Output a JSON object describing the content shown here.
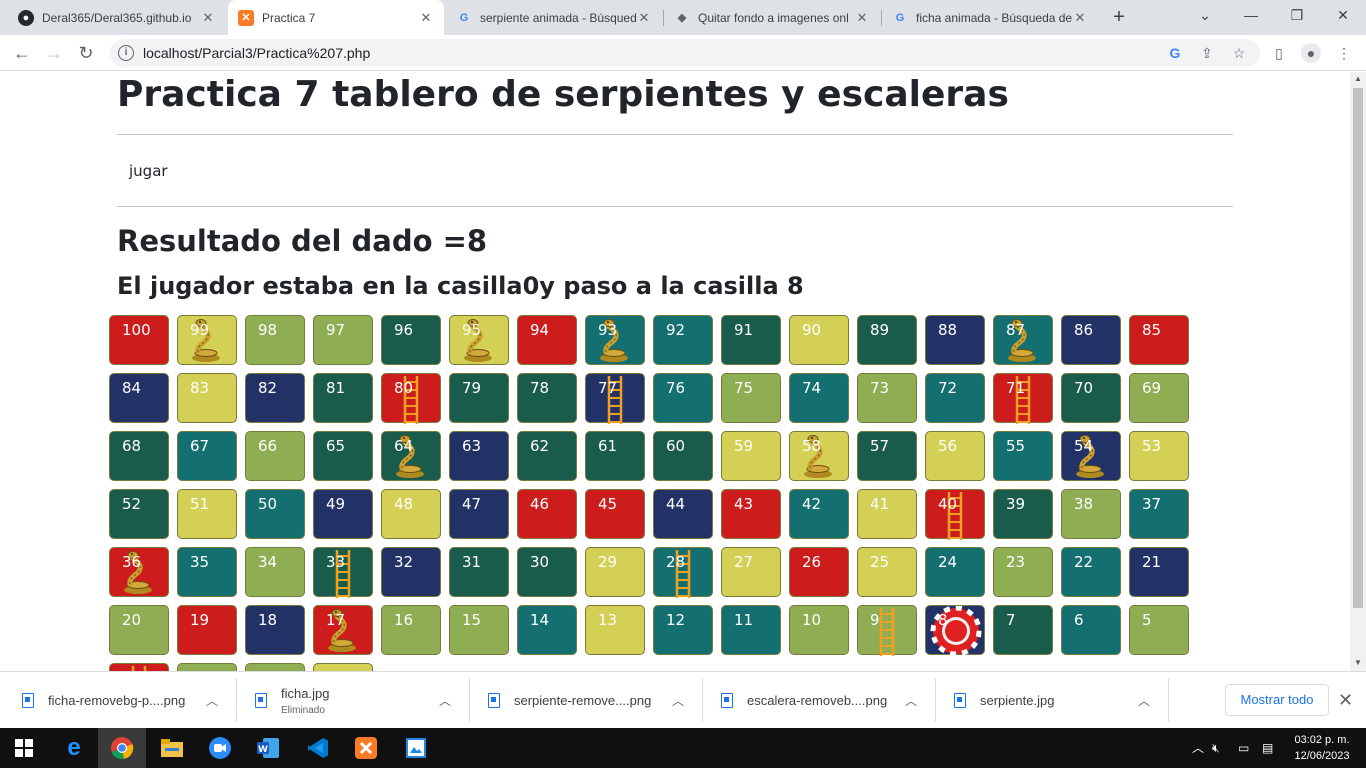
{
  "browser": {
    "tabs": [
      {
        "title": "Deral365/Deral365.github.io",
        "icon": "github-icon"
      },
      {
        "title": "Practica 7",
        "icon": "xampp-icon",
        "active": true
      },
      {
        "title": "serpiente animada - Búsqued",
        "icon": "google-icon"
      },
      {
        "title": "Quitar fondo a imagenes onl",
        "icon": "removebg-icon"
      },
      {
        "title": "ficha animada - Búsqueda de",
        "icon": "google-icon"
      }
    ],
    "url": "localhost/Parcial3/Practica%207.php"
  },
  "page": {
    "title": "Practica 7 tablero de serpientes y escaleras",
    "jugar_label": "jugar",
    "dice_result": "Resultado del dado =8",
    "move_text": "El jugador estaba en la casilla0y paso a la casilla 8"
  },
  "board": {
    "current_cell": 8,
    "colors": {
      "red": "#cc1c1c",
      "yellow": "#d4cf55",
      "olive": "#8fad52",
      "dgreen": "#1a5c4c",
      "teal": "#147070",
      "navy": "#223266"
    },
    "rows": [
      [
        {
          "n": "100",
          "c": "red"
        },
        {
          "n": "99",
          "c": "yellow",
          "o": "snake"
        },
        {
          "n": "98",
          "c": "olive"
        },
        {
          "n": "97",
          "c": "olive"
        },
        {
          "n": "96",
          "c": "dgreen"
        },
        {
          "n": "95",
          "c": "yellow",
          "o": "snake"
        },
        {
          "n": "94",
          "c": "red"
        },
        {
          "n": "93",
          "c": "teal",
          "o": "snake"
        },
        {
          "n": "92",
          "c": "teal"
        },
        {
          "n": "91",
          "c": "dgreen"
        },
        {
          "n": "90",
          "c": "yellow"
        },
        {
          "n": "89",
          "c": "dgreen"
        },
        {
          "n": "88",
          "c": "navy"
        },
        {
          "n": "87",
          "c": "teal",
          "o": "snake"
        },
        {
          "n": "86",
          "c": "navy"
        },
        {
          "n": "85",
          "c": "red"
        }
      ],
      [
        {
          "n": "84",
          "c": "navy"
        },
        {
          "n": "83",
          "c": "yellow"
        },
        {
          "n": "82",
          "c": "navy"
        },
        {
          "n": "81",
          "c": "dgreen"
        },
        {
          "n": "80",
          "c": "red",
          "o": "ladder"
        },
        {
          "n": "79",
          "c": "dgreen"
        },
        {
          "n": "78",
          "c": "dgreen"
        },
        {
          "n": "77",
          "c": "navy",
          "o": "ladder"
        },
        {
          "n": "76",
          "c": "teal"
        },
        {
          "n": "75",
          "c": "olive"
        },
        {
          "n": "74",
          "c": "teal"
        },
        {
          "n": "73",
          "c": "olive"
        },
        {
          "n": "72",
          "c": "teal"
        },
        {
          "n": "71",
          "c": "red",
          "o": "ladder"
        },
        {
          "n": "70",
          "c": "dgreen"
        },
        {
          "n": "69",
          "c": "olive"
        }
      ],
      [
        {
          "n": "68",
          "c": "dgreen"
        },
        {
          "n": "67",
          "c": "teal"
        },
        {
          "n": "66",
          "c": "olive"
        },
        {
          "n": "65",
          "c": "dgreen"
        },
        {
          "n": "64",
          "c": "dgreen",
          "o": "snake"
        },
        {
          "n": "63",
          "c": "navy"
        },
        {
          "n": "62",
          "c": "dgreen"
        },
        {
          "n": "61",
          "c": "dgreen"
        },
        {
          "n": "60",
          "c": "dgreen"
        },
        {
          "n": "59",
          "c": "yellow"
        },
        {
          "n": "58",
          "c": "yellow",
          "o": "snake"
        },
        {
          "n": "57",
          "c": "dgreen"
        },
        {
          "n": "56",
          "c": "yellow"
        },
        {
          "n": "55",
          "c": "teal"
        },
        {
          "n": "54",
          "c": "navy",
          "o": "snake"
        },
        {
          "n": "53",
          "c": "yellow"
        }
      ],
      [
        {
          "n": "52",
          "c": "dgreen"
        },
        {
          "n": "51",
          "c": "yellow"
        },
        {
          "n": "50",
          "c": "teal"
        },
        {
          "n": "49",
          "c": "navy"
        },
        {
          "n": "48",
          "c": "yellow"
        },
        {
          "n": "47",
          "c": "navy"
        },
        {
          "n": "46",
          "c": "red"
        },
        {
          "n": "45",
          "c": "red"
        },
        {
          "n": "44",
          "c": "navy"
        },
        {
          "n": "43",
          "c": "red"
        },
        {
          "n": "42",
          "c": "teal"
        },
        {
          "n": "41",
          "c": "yellow"
        },
        {
          "n": "40",
          "c": "red",
          "o": "ladder"
        },
        {
          "n": "39",
          "c": "dgreen"
        },
        {
          "n": "38",
          "c": "olive"
        },
        {
          "n": "37",
          "c": "teal"
        }
      ],
      [
        {
          "n": "36",
          "c": "red",
          "o": "snake"
        },
        {
          "n": "35",
          "c": "teal"
        },
        {
          "n": "34",
          "c": "olive"
        },
        {
          "n": "33",
          "c": "dgreen",
          "o": "ladder"
        },
        {
          "n": "32",
          "c": "navy"
        },
        {
          "n": "31",
          "c": "dgreen"
        },
        {
          "n": "30",
          "c": "dgreen"
        },
        {
          "n": "29",
          "c": "yellow"
        },
        {
          "n": "28",
          "c": "teal",
          "o": "ladder"
        },
        {
          "n": "27",
          "c": "yellow"
        },
        {
          "n": "26",
          "c": "red"
        },
        {
          "n": "25",
          "c": "yellow"
        },
        {
          "n": "24",
          "c": "teal"
        },
        {
          "n": "23",
          "c": "olive"
        },
        {
          "n": "22",
          "c": "teal"
        },
        {
          "n": "21",
          "c": "navy"
        }
      ],
      [
        {
          "n": "20",
          "c": "olive"
        },
        {
          "n": "19",
          "c": "red"
        },
        {
          "n": "18",
          "c": "navy"
        },
        {
          "n": "17",
          "c": "red",
          "o": "snake"
        },
        {
          "n": "16",
          "c": "olive"
        },
        {
          "n": "15",
          "c": "olive"
        },
        {
          "n": "14",
          "c": "teal"
        },
        {
          "n": "13",
          "c": "yellow"
        },
        {
          "n": "12",
          "c": "teal"
        },
        {
          "n": "11",
          "c": "teal"
        },
        {
          "n": "10",
          "c": "olive"
        },
        {
          "n": "9",
          "c": "olive",
          "o": "ladder"
        },
        {
          "n": "8",
          "c": "navy",
          "o": "chip"
        },
        {
          "n": "7",
          "c": "dgreen"
        },
        {
          "n": "6",
          "c": "teal"
        },
        {
          "n": "5",
          "c": "olive"
        }
      ],
      [
        {
          "n": "",
          "c": "red",
          "o": "ladder"
        },
        {
          "n": "",
          "c": "olive"
        },
        {
          "n": "",
          "c": "olive"
        },
        {
          "n": "",
          "c": "yellow"
        }
      ]
    ]
  },
  "downloads": {
    "items": [
      {
        "name": "ficha-removebg-p....png",
        "sub": ""
      },
      {
        "name": "ficha.jpg",
        "sub": "Eliminado"
      },
      {
        "name": "serpiente-remove....png",
        "sub": ""
      },
      {
        "name": "escalera-removeb....png",
        "sub": ""
      },
      {
        "name": "serpiente.jpg",
        "sub": ""
      }
    ],
    "show_all": "Mostrar todo"
  },
  "taskbar": {
    "time": "03:02 p. m.",
    "date": "12/06/2023"
  }
}
